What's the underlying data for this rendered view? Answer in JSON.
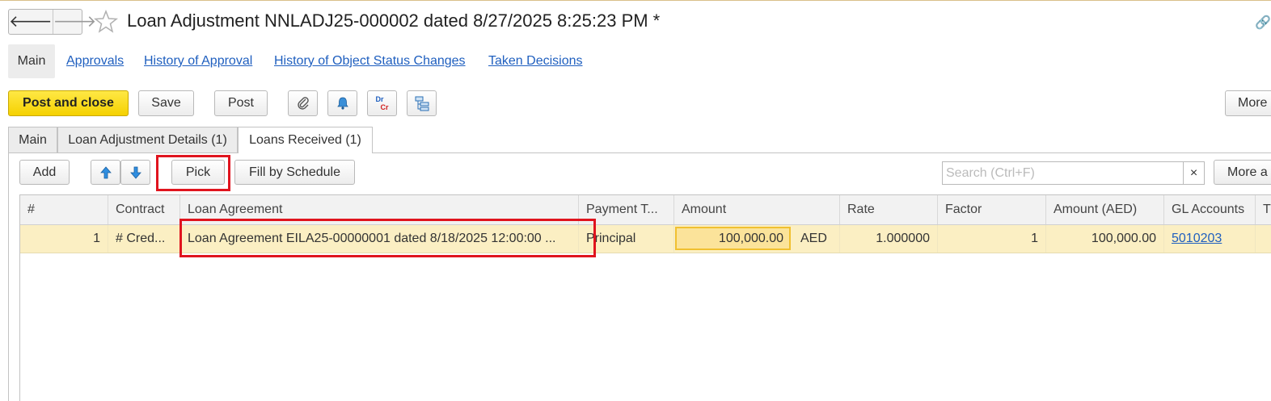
{
  "window": {
    "title": "Loan Adjustment NNLADJ25-000002 dated 8/27/2025 8:25:23 PM *"
  },
  "topnav": {
    "main": "Main",
    "links": [
      "Approvals",
      "History of Approval",
      "History of Object Status Changes",
      "Taken Decisions"
    ]
  },
  "toolbar": {
    "post_and_close": "Post and close",
    "save": "Save",
    "post": "Post",
    "icons": [
      "paperclip-icon",
      "bell-icon",
      "dr-cr-icon",
      "structure-icon"
    ],
    "dr_label": "Dr",
    "cr_label": "Cr",
    "more": "More"
  },
  "tabs": [
    "Main",
    "Loan Adjustment Details (1)",
    "Loans Received (1)"
  ],
  "subtoolbar": {
    "add": "Add",
    "pick": "Pick",
    "fill_by_schedule": "Fill by Schedule",
    "search_placeholder": "Search (Ctrl+F)",
    "clear": "×",
    "more": "More a"
  },
  "table": {
    "columns": [
      "#",
      "Contract",
      "Loan Agreement",
      "Payment T...",
      "Amount",
      "Rate",
      "Factor",
      "Amount (AED)",
      "GL Accounts",
      "T"
    ],
    "rows": [
      {
        "num": "1",
        "contract": "# Cred...",
        "loan_agreement": "Loan Agreement EILA25-00000001 dated 8/18/2025 12:00:00 ...",
        "payment_type": "Principal",
        "amount": "100,000.00",
        "currency": "AED",
        "rate": "1.000000",
        "factor": "1",
        "amount_aed": "100,000.00",
        "gl_account": "5010203"
      }
    ]
  },
  "colors": {
    "accent_yellow": "#f5d100",
    "selected_row": "#fbefc3",
    "link_blue": "#1f5fbf",
    "highlight_red": "#e0141e"
  }
}
